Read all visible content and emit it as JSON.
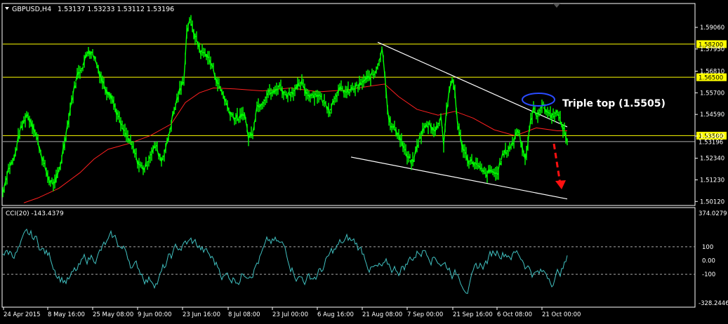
{
  "header": {
    "symbol_tf": "GBPUSD,H4",
    "ohlc": "1.53137 1.53233 1.53112 1.53196",
    "indicator_label": "CCI(20) -143.4379"
  },
  "annotation": {
    "text": "Triple top (1.5505)"
  },
  "colors": {
    "background": "#000000",
    "price": "#00ff00",
    "moving_average": "#ff2020",
    "cci": "#40c0c0",
    "level_line": "#ffff00",
    "level_label_bg": "#ffff00",
    "current_price_line": "#b0b0b0",
    "trendline": "#ffffff",
    "ellipse": "#2a4bff",
    "arrow": "#ff1010",
    "axis_text": "#ffffff"
  },
  "chart_data": [
    {
      "type": "line",
      "title": "GBPUSD,H4",
      "series": [],
      "x_tick_labels": [
        "24 Apr 2015",
        "8 May 16:00",
        "25 May 08:00",
        "9 Jun 00:00",
        "23 Jun 16:00",
        "8 Jul 08:00",
        "23 Jul 00:00",
        "6 Aug 16:00",
        "21 Aug 08:00",
        "7 Sep 00:00",
        "21 Sep 16:00",
        "6 Oct 08:00",
        "21 Oct 00:00"
      ],
      "y_tick_labels": [
        "1.59060",
        "1.57950",
        "1.56810",
        "1.55700",
        "1.54590",
        "1.53480",
        "1.52340",
        "1.51230",
        "1.50120"
      ],
      "ylim": [
        1.4995,
        1.6025
      ],
      "horizontal_levels": [
        {
          "value": 1.582,
          "label": "1.58200"
        },
        {
          "value": 1.565,
          "label": "1.56500"
        },
        {
          "value": 1.535,
          "label": "1.53500"
        }
      ],
      "current_price": {
        "value": 1.53196,
        "label": "1.53196"
      },
      "price_path": [
        [
          0,
          1.506
        ],
        [
          4,
          1.518
        ],
        [
          8,
          1.523
        ],
        [
          12,
          1.537
        ],
        [
          17,
          1.546
        ],
        [
          21,
          1.541
        ],
        [
          25,
          1.532
        ],
        [
          29,
          1.521
        ],
        [
          33,
          1.512
        ],
        [
          37,
          1.51
        ],
        [
          41,
          1.52
        ],
        [
          45,
          1.536
        ],
        [
          49,
          1.553
        ],
        [
          53,
          1.566
        ],
        [
          57,
          1.571
        ],
        [
          61,
          1.579
        ],
        [
          65,
          1.576
        ],
        [
          69,
          1.567
        ],
        [
          73,
          1.559
        ],
        [
          77,
          1.556
        ],
        [
          81,
          1.547
        ],
        [
          85,
          1.539
        ],
        [
          89,
          1.534
        ],
        [
          93,
          1.528
        ],
        [
          97,
          1.52
        ],
        [
          101,
          1.518
        ],
        [
          105,
          1.525
        ],
        [
          109,
          1.53
        ],
        [
          113,
          1.522
        ],
        [
          117,
          1.531
        ],
        [
          121,
          1.545
        ],
        [
          125,
          1.556
        ],
        [
          129,
          1.564
        ],
        [
          131,
          1.588
        ],
        [
          133,
          1.595
        ],
        [
          135,
          1.59
        ],
        [
          137,
          1.586
        ],
        [
          141,
          1.578
        ],
        [
          145,
          1.577
        ],
        [
          149,
          1.571
        ],
        [
          153,
          1.562
        ],
        [
          157,
          1.556
        ],
        [
          161,
          1.548
        ],
        [
          165,
          1.544
        ],
        [
          169,
          1.544
        ],
        [
          172,
          1.547
        ],
        [
          175,
          1.534
        ],
        [
          178,
          1.537
        ],
        [
          181,
          1.55
        ],
        [
          185,
          1.552
        ],
        [
          189,
          1.557
        ],
        [
          193,
          1.557
        ],
        [
          197,
          1.561
        ],
        [
          201,
          1.556
        ],
        [
          205,
          1.557
        ],
        [
          209,
          1.559
        ],
        [
          213,
          1.562
        ],
        [
          217,
          1.556
        ],
        [
          221,
          1.556
        ],
        [
          225,
          1.556
        ],
        [
          229,
          1.552
        ],
        [
          233,
          1.548
        ],
        [
          237,
          1.556
        ],
        [
          241,
          1.559
        ],
        [
          245,
          1.557
        ],
        [
          249,
          1.559
        ],
        [
          253,
          1.56
        ],
        [
          257,
          1.563
        ],
        [
          261,
          1.565
        ],
        [
          265,
          1.567
        ],
        [
          269,
          1.576
        ],
        [
          270,
          1.58
        ],
        [
          272,
          1.568
        ],
        [
          274,
          1.549
        ],
        [
          276,
          1.54
        ],
        [
          280,
          1.538
        ],
        [
          284,
          1.532
        ],
        [
          288,
          1.524
        ],
        [
          292,
          1.521
        ],
        [
          296,
          1.532
        ],
        [
          300,
          1.539
        ],
        [
          304,
          1.541
        ],
        [
          308,
          1.537
        ],
        [
          312,
          1.545
        ],
        [
          314,
          1.531
        ],
        [
          316,
          1.548
        ],
        [
          318,
          1.557
        ],
        [
          320,
          1.564
        ],
        [
          322,
          1.558
        ],
        [
          324,
          1.54
        ],
        [
          328,
          1.528
        ],
        [
          332,
          1.522
        ],
        [
          336,
          1.521
        ],
        [
          340,
          1.518
        ],
        [
          344,
          1.515
        ],
        [
          348,
          1.517
        ],
        [
          352,
          1.515
        ],
        [
          356,
          1.525
        ],
        [
          360,
          1.528
        ],
        [
          364,
          1.532
        ],
        [
          366,
          1.538
        ],
        [
          368,
          1.536
        ],
        [
          370,
          1.529
        ],
        [
          372,
          1.523
        ],
        [
          374,
          1.531
        ],
        [
          376,
          1.543
        ],
        [
          378,
          1.549
        ],
        [
          380,
          1.545
        ],
        [
          382,
          1.548
        ],
        [
          384,
          1.55
        ],
        [
          386,
          1.549
        ],
        [
          388,
          1.547
        ],
        [
          390,
          1.546
        ],
        [
          392,
          1.545
        ],
        [
          394,
          1.548
        ],
        [
          396,
          1.544
        ],
        [
          398,
          1.541
        ],
        [
          400,
          1.537
        ],
        [
          402,
          1.532
        ]
      ],
      "moving_average_path": [
        [
          15,
          1.5005
        ],
        [
          25,
          1.503
        ],
        [
          40,
          1.508
        ],
        [
          55,
          1.516
        ],
        [
          65,
          1.523
        ],
        [
          75,
          1.528
        ],
        [
          90,
          1.531
        ],
        [
          105,
          1.535
        ],
        [
          120,
          1.541
        ],
        [
          130,
          1.552
        ],
        [
          140,
          1.557
        ],
        [
          150,
          1.5595
        ],
        [
          165,
          1.559
        ],
        [
          185,
          1.558
        ],
        [
          205,
          1.5595
        ],
        [
          225,
          1.5575
        ],
        [
          245,
          1.5585
        ],
        [
          262,
          1.5605
        ],
        [
          272,
          1.5615
        ],
        [
          282,
          1.555
        ],
        [
          295,
          1.5485
        ],
        [
          310,
          1.5455
        ],
        [
          322,
          1.5475
        ],
        [
          335,
          1.544
        ],
        [
          350,
          1.538
        ],
        [
          365,
          1.535
        ],
        [
          380,
          1.539
        ],
        [
          395,
          1.5375
        ],
        [
          402,
          1.5375
        ]
      ],
      "trendlines": [
        {
          "from": [
            267,
            1.583
          ],
          "to": [
            402,
            1.5395
          ]
        },
        {
          "from": [
            248,
            1.524
          ],
          "to": [
            402,
            1.5025
          ]
        }
      ],
      "x_max": 520
    },
    {
      "type": "line",
      "title": "CCI(20) -143.4379",
      "series": [],
      "y_tick_labels": [
        "374.0279",
        "100",
        "0.00",
        "-100",
        "-328.2446"
      ],
      "ylim": [
        -328.2446,
        374.0279
      ],
      "levels": [
        100,
        -100
      ],
      "x_max": 520
    }
  ]
}
